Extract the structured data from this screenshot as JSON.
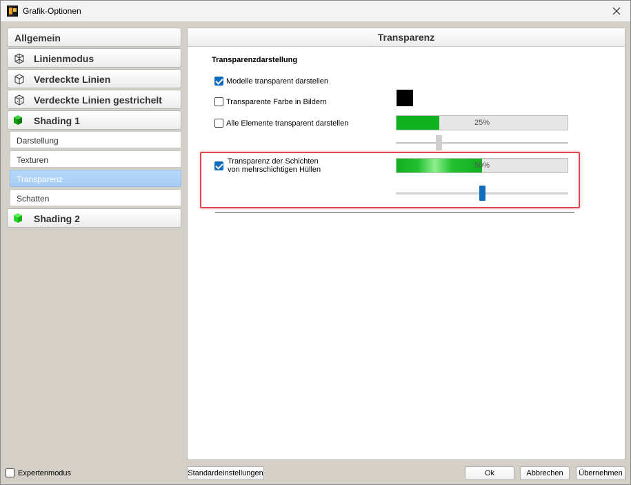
{
  "window": {
    "title": "Grafik-Optionen"
  },
  "sidebar": {
    "items": [
      {
        "label": "Allgemein",
        "icon": "none"
      },
      {
        "label": "Linienmodus",
        "icon": "wireframe-cube-icon"
      },
      {
        "label": "Verdeckte Linien",
        "icon": "hidden-lines-cube-icon"
      },
      {
        "label": "Verdeckte Linien gestrichelt",
        "icon": "dashed-cube-icon"
      },
      {
        "label": "Shading 1",
        "icon": "green-cube-icon"
      }
    ],
    "subitems": [
      {
        "label": "Darstellung",
        "active": false
      },
      {
        "label": "Texturen",
        "active": false
      },
      {
        "label": "Transparenz",
        "active": true
      },
      {
        "label": "Schatten",
        "active": false
      }
    ],
    "after_items": [
      {
        "label": "Shading 2",
        "icon": "green-cube-icon"
      }
    ],
    "expert_mode": {
      "label": "Expertenmodus",
      "checked": false
    }
  },
  "panel": {
    "header": "Transparenz",
    "section_title": "Transparenzdarstellung",
    "options": {
      "models_transparent": {
        "label": "Modelle transparent darstellen",
        "checked": true
      },
      "transparent_color": {
        "label": "Transparente Farbe in Bildern",
        "checked": false,
        "swatch_color": "#000000"
      },
      "all_elements": {
        "label": "Alle Elemente transparent darstellen",
        "checked": false,
        "percent": 25,
        "percent_text": "25%"
      },
      "layers": {
        "label_line1": "Transparenz der Schichten",
        "label_line2": "von mehrschichtigen Hüllen",
        "checked": true,
        "percent": 50,
        "percent_text": "50%"
      }
    }
  },
  "buttons": {
    "defaults": "Standardeinstellungen",
    "ok": "Ok",
    "cancel": "Abbrechen",
    "apply": "Übernehmen"
  },
  "colors": {
    "accent": "#0f6cbd",
    "progress": "#0fb320",
    "highlight": "#e0474c"
  }
}
